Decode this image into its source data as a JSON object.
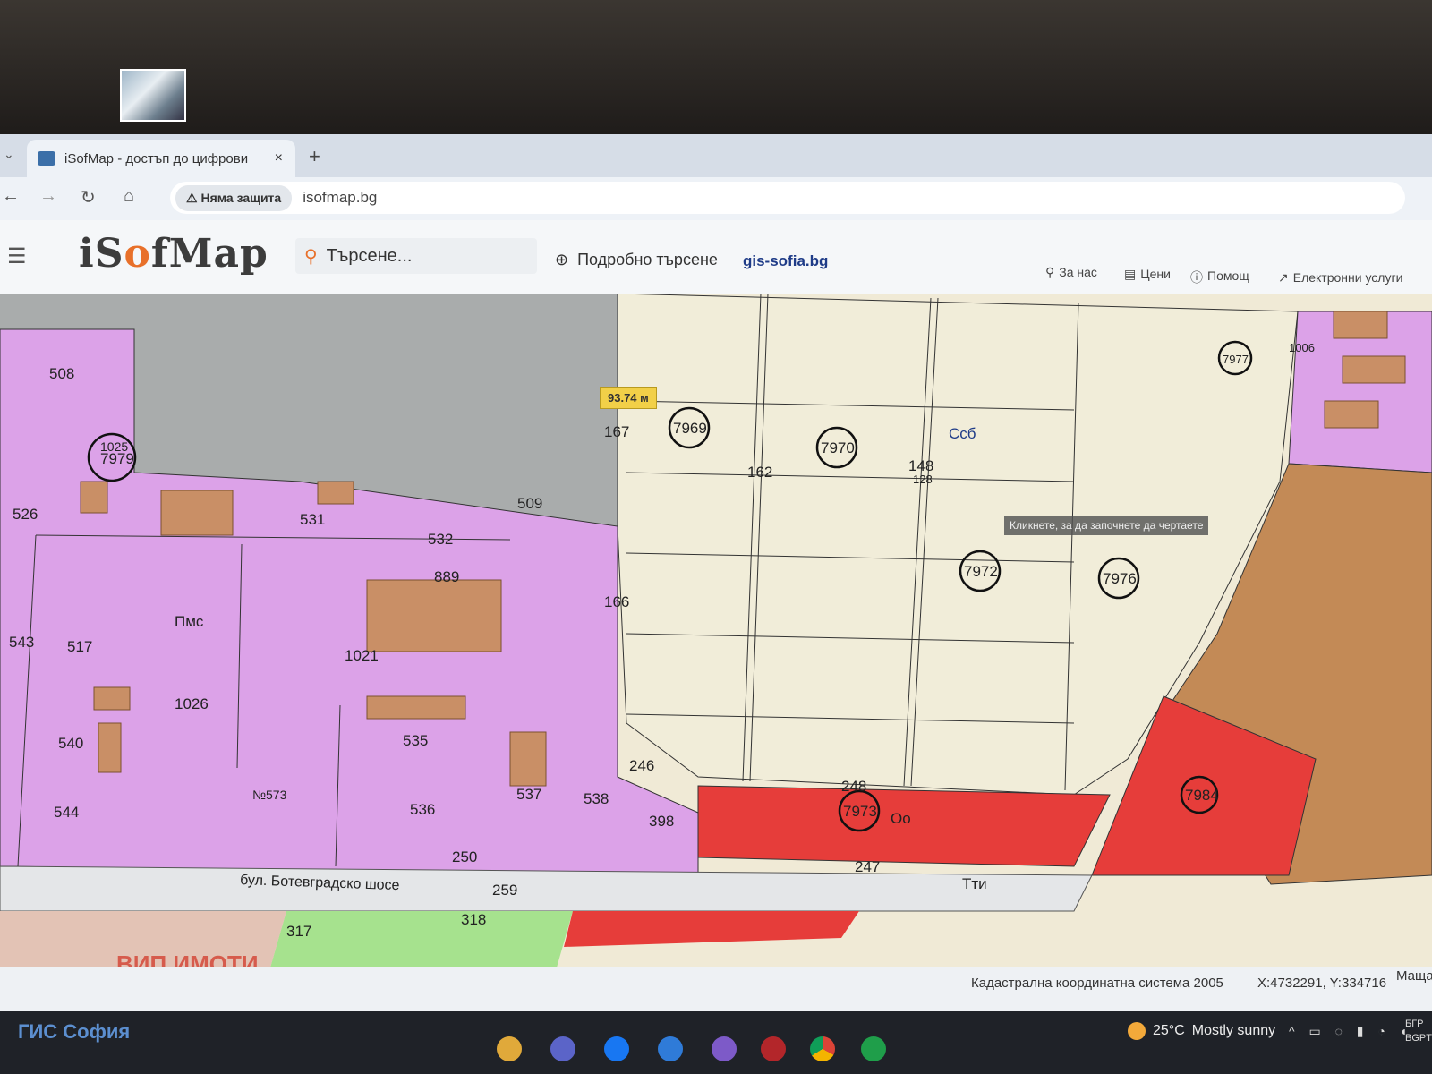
{
  "browser": {
    "tab_title": "iSofMap - достъп до цифрови",
    "tab_close": "×",
    "new_tab": "+",
    "security_label": "Няма защита",
    "url": "isofmap.bg",
    "star": "☆"
  },
  "site": {
    "logo_pre": "iS",
    "logo_pin": "o",
    "logo_post": "fMap",
    "search_placeholder": "Търсене...",
    "advanced_search": "Подробно търсене",
    "gis_link": "gis-sofia.bg",
    "nav": {
      "about": "За нас",
      "prices": "Цени",
      "help": "Помощ",
      "eservices": "Електронни услуги"
    }
  },
  "map": {
    "scale_badge": "93.74 м",
    "tooltip": "Кликнете, за да започнете да чертаете",
    "watermark": "ВИП ИМОТИ",
    "road_label": "бул. Ботевградско шосе",
    "zone_labels": {
      "pms": "Пмс",
      "ssb": "Ссб",
      "oo": "Оо",
      "tti": "Тти",
      "no573": "№573"
    },
    "block_labels": [
      "7979",
      "1025",
      "7969",
      "7970",
      "7972",
      "7976",
      "7973",
      "7984",
      "7977"
    ],
    "parcel_labels": [
      "508",
      "526",
      "531",
      "532",
      "509",
      "889",
      "1021",
      "1026",
      "517",
      "540",
      "543",
      "544",
      "535",
      "536",
      "537",
      "538",
      "398",
      "246",
      "248",
      "250",
      "259",
      "318",
      "317",
      "247",
      "167",
      "166",
      "162",
      "148",
      "128",
      "1006"
    ]
  },
  "status": {
    "crs": "Кадастрална координатна система 2005",
    "coords": "X:4732291, Y:334716",
    "scale_label": "Маща"
  },
  "taskbar": {
    "footer_brand": "ГИС София",
    "weather_temp": "25°C",
    "weather_desc": "Mostly sunny",
    "lang_top": "БГР",
    "lang_bottom": "BGPT"
  }
}
